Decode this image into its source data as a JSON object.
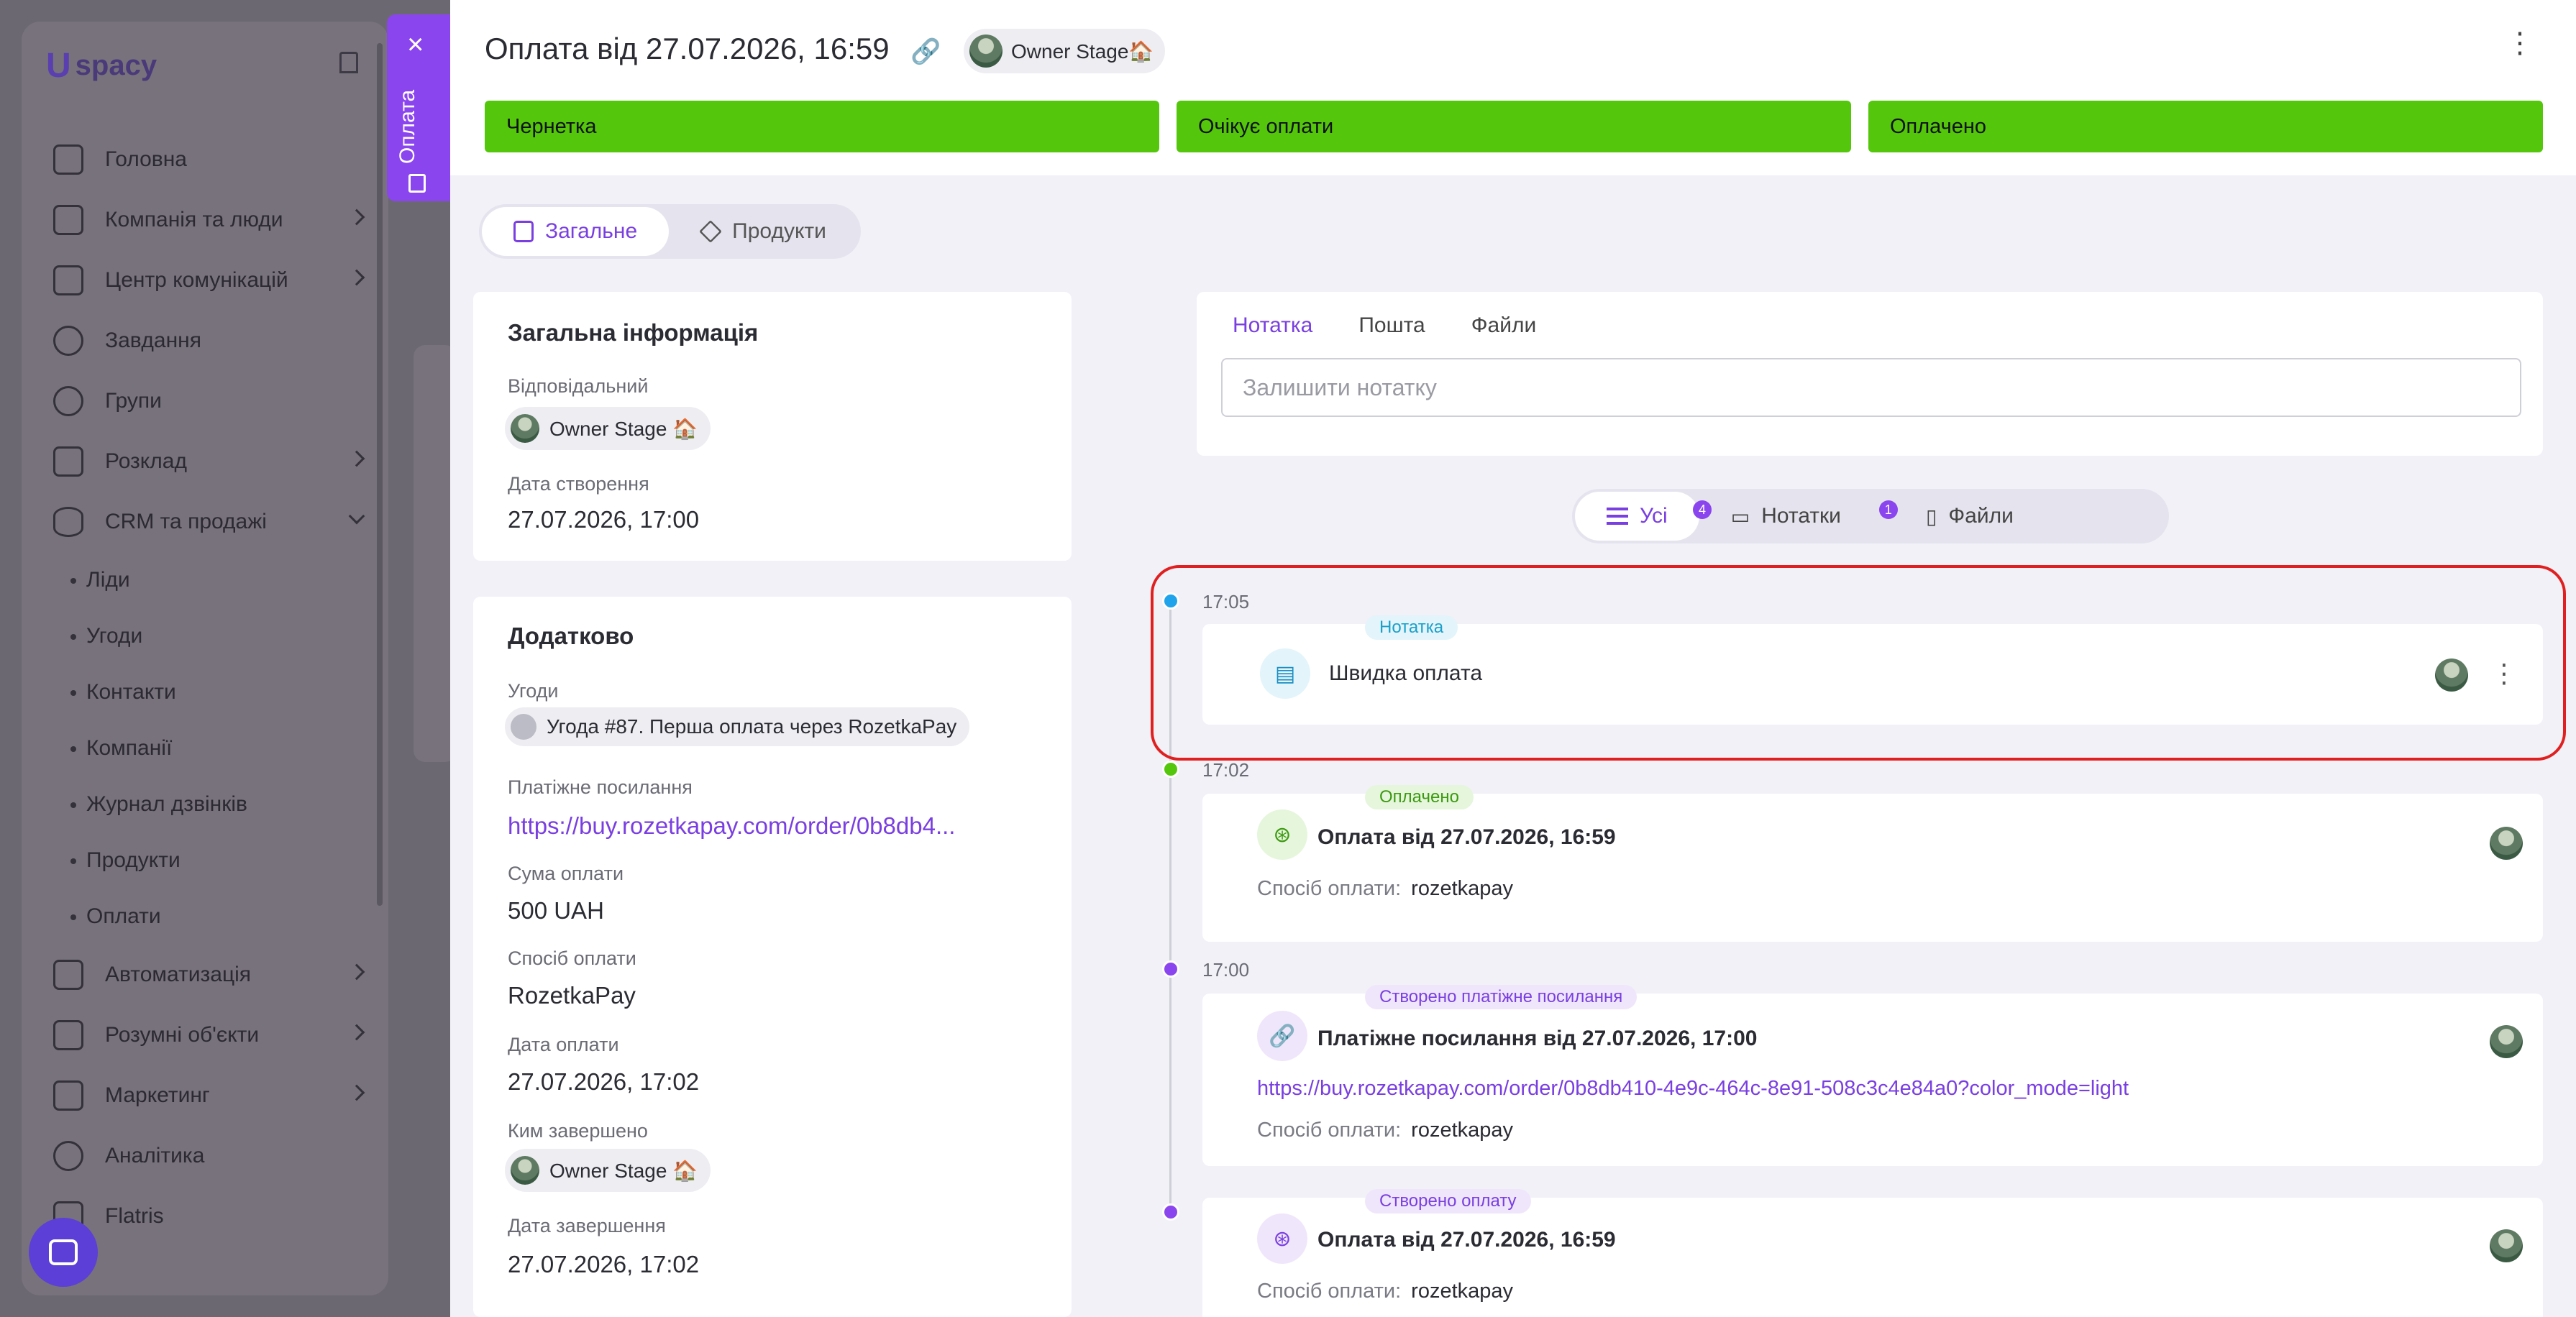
{
  "app": {
    "logo": "spacy",
    "nav": [
      {
        "label": "Головна",
        "chevron": false
      },
      {
        "label": "Компанія та люди",
        "chevron": true
      },
      {
        "label": "Центр комунікацій",
        "chevron": true
      },
      {
        "label": "Завдання",
        "chevron": false
      },
      {
        "label": "Групи",
        "chevron": false
      },
      {
        "label": "Розклад",
        "chevron": true
      },
      {
        "label": "CRM та продажі",
        "chevron": "down"
      }
    ],
    "crm_sub": [
      "Ліди",
      "Угоди",
      "Контакти",
      "Компанії",
      "Журнал дзвінків",
      "Продукти",
      "Оплати"
    ],
    "nav_bottom": [
      {
        "label": "Автоматизація",
        "chevron": true
      },
      {
        "label": "Розумні об'єкти",
        "chevron": true
      },
      {
        "label": "Маркетинг",
        "chevron": true
      },
      {
        "label": "Аналітика",
        "chevron": false
      },
      {
        "label": "Flatris",
        "chevron": false
      }
    ]
  },
  "side_tab": {
    "label": "Оплата"
  },
  "header": {
    "title": "Оплата від 27.07.2026, 16:59",
    "owner": "Owner Stage🏠",
    "stages": [
      "Чернетка",
      "Очікує оплати",
      "Оплачено"
    ],
    "stage_color": "#54c70d"
  },
  "tabs": [
    "Загальне",
    "Продукти"
  ],
  "general": {
    "heading": "Загальна інформація",
    "responsible_label": "Відповідальний",
    "responsible": "Owner Stage 🏠",
    "created_label": "Дата створення",
    "created": "27.07.2026, 17:00"
  },
  "extra": {
    "heading": "Додатково",
    "deals_label": "Угоди",
    "deal": "Угода #87. Перша оплата через RozetkaPay",
    "link_label": "Платіжне посилання",
    "link": "https://buy.rozetkapay.com/order/0b8db4...",
    "amount_label": "Сума оплати",
    "amount": "500 UAH",
    "method_label": "Спосіб оплати",
    "method": "RozetkaPay",
    "paid_label": "Дата оплати",
    "paid": "27.07.2026, 17:02",
    "completed_by_label": "Ким завершено",
    "completed_by": "Owner Stage 🏠",
    "completed_label": "Дата завершення",
    "completed": "27.07.2026, 17:02"
  },
  "note": {
    "tabs": [
      "Нотатка",
      "Пошта",
      "Файли"
    ],
    "placeholder": "Залишити нотатку"
  },
  "filter": {
    "all": "Усі",
    "all_count": "4",
    "notes": "Нотатки",
    "notes_count": "1",
    "files": "Файли"
  },
  "timeline": [
    {
      "time": "17:05",
      "pill": "Нотатка",
      "title": "Швидка оплата"
    },
    {
      "time": "17:02",
      "pill": "Оплачено",
      "title": "Оплата від 27.07.2026, 16:59",
      "meta_label": "Спосіб оплати:",
      "meta_value": "rozetkapay"
    },
    {
      "time": "17:00",
      "pill": "Створено платіжне посилання",
      "title": "Платіжне посилання від 27.07.2026, 17:00",
      "link": "https://buy.rozetkapay.com/order/0b8db410-4e9c-464c-8e91-508c3c4e84a0?color_mode=light",
      "meta_label": "Спосіб оплати:",
      "meta_value": "rozetkapay"
    },
    {
      "time": "",
      "pill": "Створено оплату",
      "title": "Оплата від 27.07.2026, 16:59",
      "meta_label": "Спосіб оплати:",
      "meta_value": "rozetkapay"
    }
  ],
  "colors": {
    "accent": "#8b45ee",
    "link": "#7a3fe0",
    "highlight": "#e02020"
  }
}
